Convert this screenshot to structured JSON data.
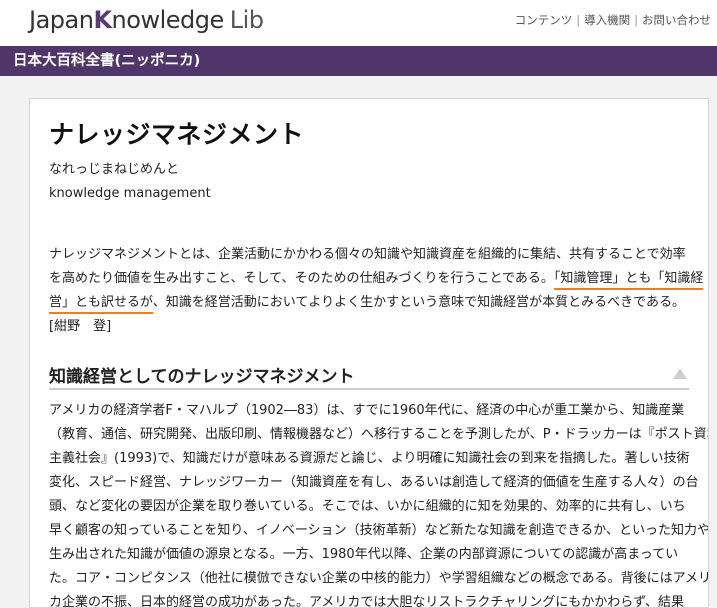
{
  "header": {
    "logo_japan": "Japan",
    "logo_k": "K",
    "logo_nowledge": "nowledge",
    "logo_lib": "Lib",
    "nav": [
      "コンテンツ",
      "導入機関",
      "お問い合わせ"
    ],
    "nav_sep": "|"
  },
  "titlebar": {
    "title": "日本大百科全書(ニッポニカ)"
  },
  "entry": {
    "headword": "ナレッジマネジメント",
    "reading": "なれっじまねじめんと",
    "english": "knowledge management",
    "intro_lines": [
      {
        "a": "ナレッジマネジメントとは、企業活動にかかわる個々の知識や知識資産を組織的に集結、共有することで効率",
        "hl": "",
        "b": ""
      },
      {
        "a": "を高めたり価値を生み出すこと、そして、そのための仕組みづくりを行うことである。",
        "hl": "「知識管理」とも「知識経",
        "b": ""
      },
      {
        "a": "",
        "hl": "営」とも訳せるが",
        "b": "、知識を経営活動においてよりよく生かすという意味で知識経営が本質とみるべきである。"
      },
      {
        "a": "[紺野　登]",
        "hl": "",
        "b": ""
      }
    ],
    "section_title": "知識経営としてのナレッジマネジメント",
    "body_lines": [
      "アメリカの経済学者F・マハルプ（1902―83）は、すでに1960年代に、経済の中心が重工業から、知識産業",
      "（教育、通信、研究開発、出版印刷、情報機器など）へ移行することを予測したが、P・ドラッカーは『ポスト資本",
      "主義社会』(1993)で、知識だけが意味ある資源だと論じ、より明確に知識社会の到来を指摘した。著しい技術",
      "変化、スピード経営、ナレッジワーカー（知識資産を有し、あるいは創造して経済的価値を生産する人々）の台",
      "頭、など変化の要因が企業を取り巻いている。そこでは、いかに組織的に知を効果的、効率的に共有し、いち",
      "早く顧客の知っていることを知り、イノベーション（技術革新）など新たな知識を創造できるか、といった知力や、",
      "生み出された知識が価値の源泉となる。一方、1980年代以降、企業の内部資源についての認識が高まってい",
      "た。コア・コンピタンス（他社に模倣できない企業の中核的能力）や学習組織などの概念である。背後にはアメリ",
      "カ企業の不振、日本的経営の成功があった。アメリカでは大胆なリストラクチャリングにもかかわらず、結果"
    ]
  },
  "colors": {
    "brand": "#4f3569",
    "highlight": "#f07d1a"
  }
}
